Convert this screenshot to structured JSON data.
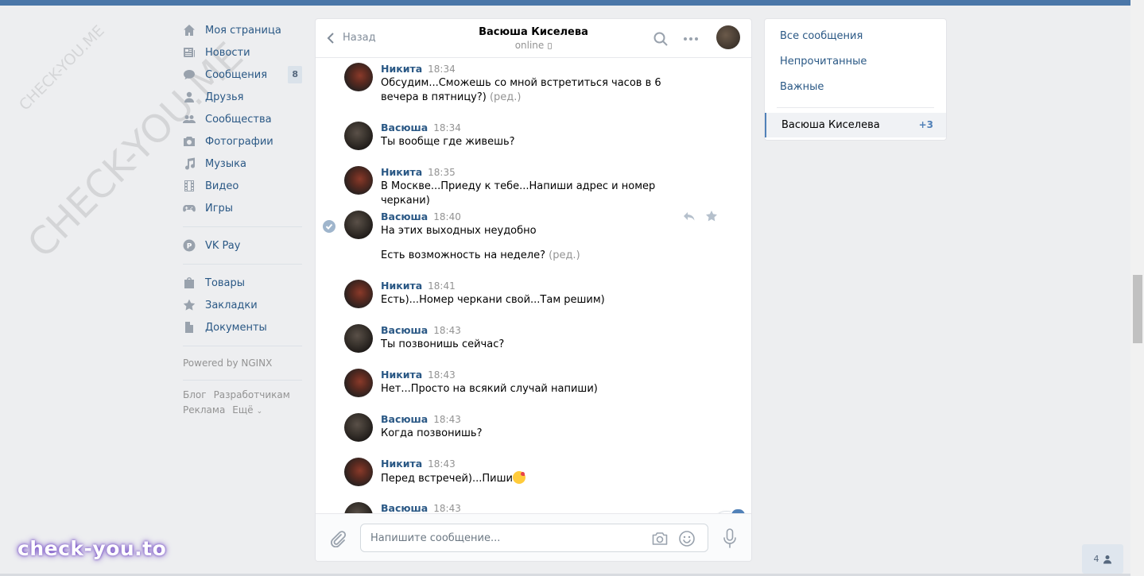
{
  "watermark": {
    "small": "CHECK-YOU.ME",
    "large": "CHECK-YOU.ME",
    "brand": "check-you.to"
  },
  "sidebar": {
    "items": [
      {
        "label": "Моя страница",
        "icon": "home-icon"
      },
      {
        "label": "Новости",
        "icon": "news-icon"
      },
      {
        "label": "Сообщения",
        "icon": "messages-icon",
        "badge": "8"
      },
      {
        "label": "Друзья",
        "icon": "friend-icon"
      },
      {
        "label": "Сообщества",
        "icon": "groups-icon"
      },
      {
        "label": "Фотографии",
        "icon": "camera-icon"
      },
      {
        "label": "Музыка",
        "icon": "music-icon"
      },
      {
        "label": "Видео",
        "icon": "video-icon"
      },
      {
        "label": "Игры",
        "icon": "gamepad-icon"
      }
    ],
    "vkpay": "VK Pay",
    "extra": [
      "Товары",
      "Закладки",
      "Документы"
    ],
    "powered": "Powered by NGINX",
    "footer": {
      "blog": "Блог",
      "dev": "Разработчикам",
      "ads": "Реклама",
      "more": "Ещё"
    }
  },
  "chat": {
    "back_label": "Назад",
    "peer_name": "Васюша Киселева",
    "peer_status": "online",
    "messages": [
      {
        "author": "Никита",
        "time": "18:34",
        "text": "Обсудим...Сможешь со мной встретиться часов в 6 вечера в пятницу?)",
        "edited": "(ред.)"
      },
      {
        "author": "Васюша",
        "time": "18:34",
        "text": "Ты вообще где живешь?"
      },
      {
        "author": "Никита",
        "time": "18:35",
        "text": "В Москве...Приеду к тебе...Напиши адрес и номер черкани)"
      },
      {
        "author": "Васюша",
        "time": "18:40",
        "text": "На этих выходных неудобно",
        "text2": "Есть возможность на неделе?",
        "edited": "(ред.)"
      },
      {
        "author": "Никита",
        "time": "18:41",
        "text": "Есть)...Номер черкани свой...Там решим)"
      },
      {
        "author": "Васюша",
        "time": "18:43",
        "text": "Ты позвонишь сейчас?"
      },
      {
        "author": "Никита",
        "time": "18:43",
        "text": "Нет...Просто на всякий случай напиши)"
      },
      {
        "author": "Васюша",
        "time": "18:43",
        "text": "Когда позвонишь?"
      },
      {
        "author": "Никита",
        "time": "18:43",
        "text": "Перед встречей)...Пиши"
      },
      {
        "author": "Васюша",
        "time": "18:43",
        "text": ""
      }
    ],
    "unread_badge": "3",
    "input_placeholder": "Напишите сообщение..."
  },
  "right_panel": {
    "all": "Все сообщения",
    "unread": "Непрочитанные",
    "important": "Важные",
    "active_chat": "Васюша Киселева",
    "active_count": "+3"
  },
  "online_count": "4",
  "colors": {
    "accent": "#4a76a8",
    "link": "#2a5885",
    "badge": "#5181b8"
  }
}
